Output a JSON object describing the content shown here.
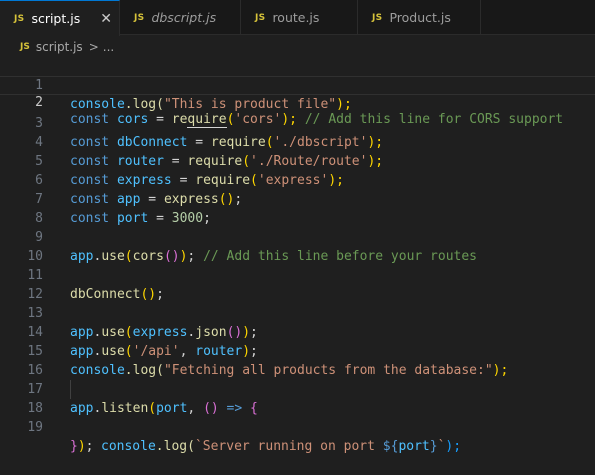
{
  "tabs": [
    {
      "badge": "JS",
      "label": "script.js",
      "close": "✕"
    },
    {
      "badge": "JS",
      "label": "dbscript.js"
    },
    {
      "badge": "JS",
      "label": "route.js"
    },
    {
      "badge": "JS",
      "label": "Product.js"
    }
  ],
  "breadcrumb": {
    "badge": "JS",
    "file": "script.js",
    "sep": ">",
    "more": "..."
  },
  "editor": {
    "line_numbers": [
      "1",
      "2",
      "3",
      "4",
      "5",
      "6",
      "7",
      "8",
      "9",
      "10",
      "11",
      "12",
      "13",
      "14",
      "15",
      "16",
      "17",
      "18",
      "19"
    ],
    "current_line": 2,
    "lines": {
      "l1": {
        "a": "console",
        "b": ".log(",
        "c": "\"This is product file\"",
        "d": ");"
      },
      "l2": {
        "kw": "const",
        "v": "cors",
        "eq": " = ",
        "f1": "re",
        "f2": "quire",
        "o": "(",
        "s": "'cors'",
        "cl": ");",
        "cm": " // Add this line for CORS support"
      },
      "l3": {
        "kw": "const",
        "v": "dbConnect",
        "eq": " = ",
        "f": "require",
        "o": "(",
        "s": "'./dbscript'",
        "cl": ");"
      },
      "l4": {
        "kw": "const",
        "v": "router",
        "eq": " = ",
        "f": "require",
        "o": "(",
        "s": "'./Route/route'",
        "cl": ");"
      },
      "l5": {
        "kw": "const",
        "v": "express",
        "eq": " = ",
        "f": "require",
        "o": "(",
        "s": "'express'",
        "cl": ");"
      },
      "l6": {
        "kw": "const",
        "v": "app",
        "eq": " = ",
        "f": "express",
        "o": "()",
        "cl": ";"
      },
      "l7": {
        "kw": "const",
        "v": "port",
        "eq": " = ",
        "n": "3000",
        "cl": ";"
      },
      "l9": {
        "v": "app",
        "dot": ".",
        "f": "use",
        "o": "(",
        "f2": "cors",
        "o2": "()",
        "c2": ")",
        "cl": ";",
        "cm": " // Add this line before your routes"
      },
      "l11": {
        "f": "dbConnect",
        "o": "()",
        "cl": ";"
      },
      "l13": {
        "v": "app",
        "dot": ".",
        "f": "use",
        "o": "(",
        "v2": "express",
        "dot2": ".",
        "f2": "json",
        "o2": "()",
        "c2": ")",
        "cl": ";"
      },
      "l14": {
        "v": "app",
        "dot": ".",
        "f": "use",
        "o": "(",
        "s": "'/api'",
        "comma": ", ",
        "v2": "router",
        "c2": ")",
        "cl": ";"
      },
      "l15": {
        "a": "console",
        "b": ".log(",
        "c": "\"Fetching all products from the database:\"",
        "d": ");"
      },
      "l17": {
        "v": "app",
        "dot": ".",
        "f": "listen",
        "o": "(",
        "v2": "port",
        "comma": ", ",
        "o2": "()",
        "arrow": " => ",
        "br": "{"
      },
      "l18": {
        "a": "console",
        "b": ".log(",
        "s1": "`Server running on port ",
        "t1": "${",
        "v": "port",
        "t2": "}",
        "s2": "`",
        "d": ");"
      },
      "l19": {
        "br": "}",
        "c2": ")",
        "cl": ";"
      }
    }
  }
}
